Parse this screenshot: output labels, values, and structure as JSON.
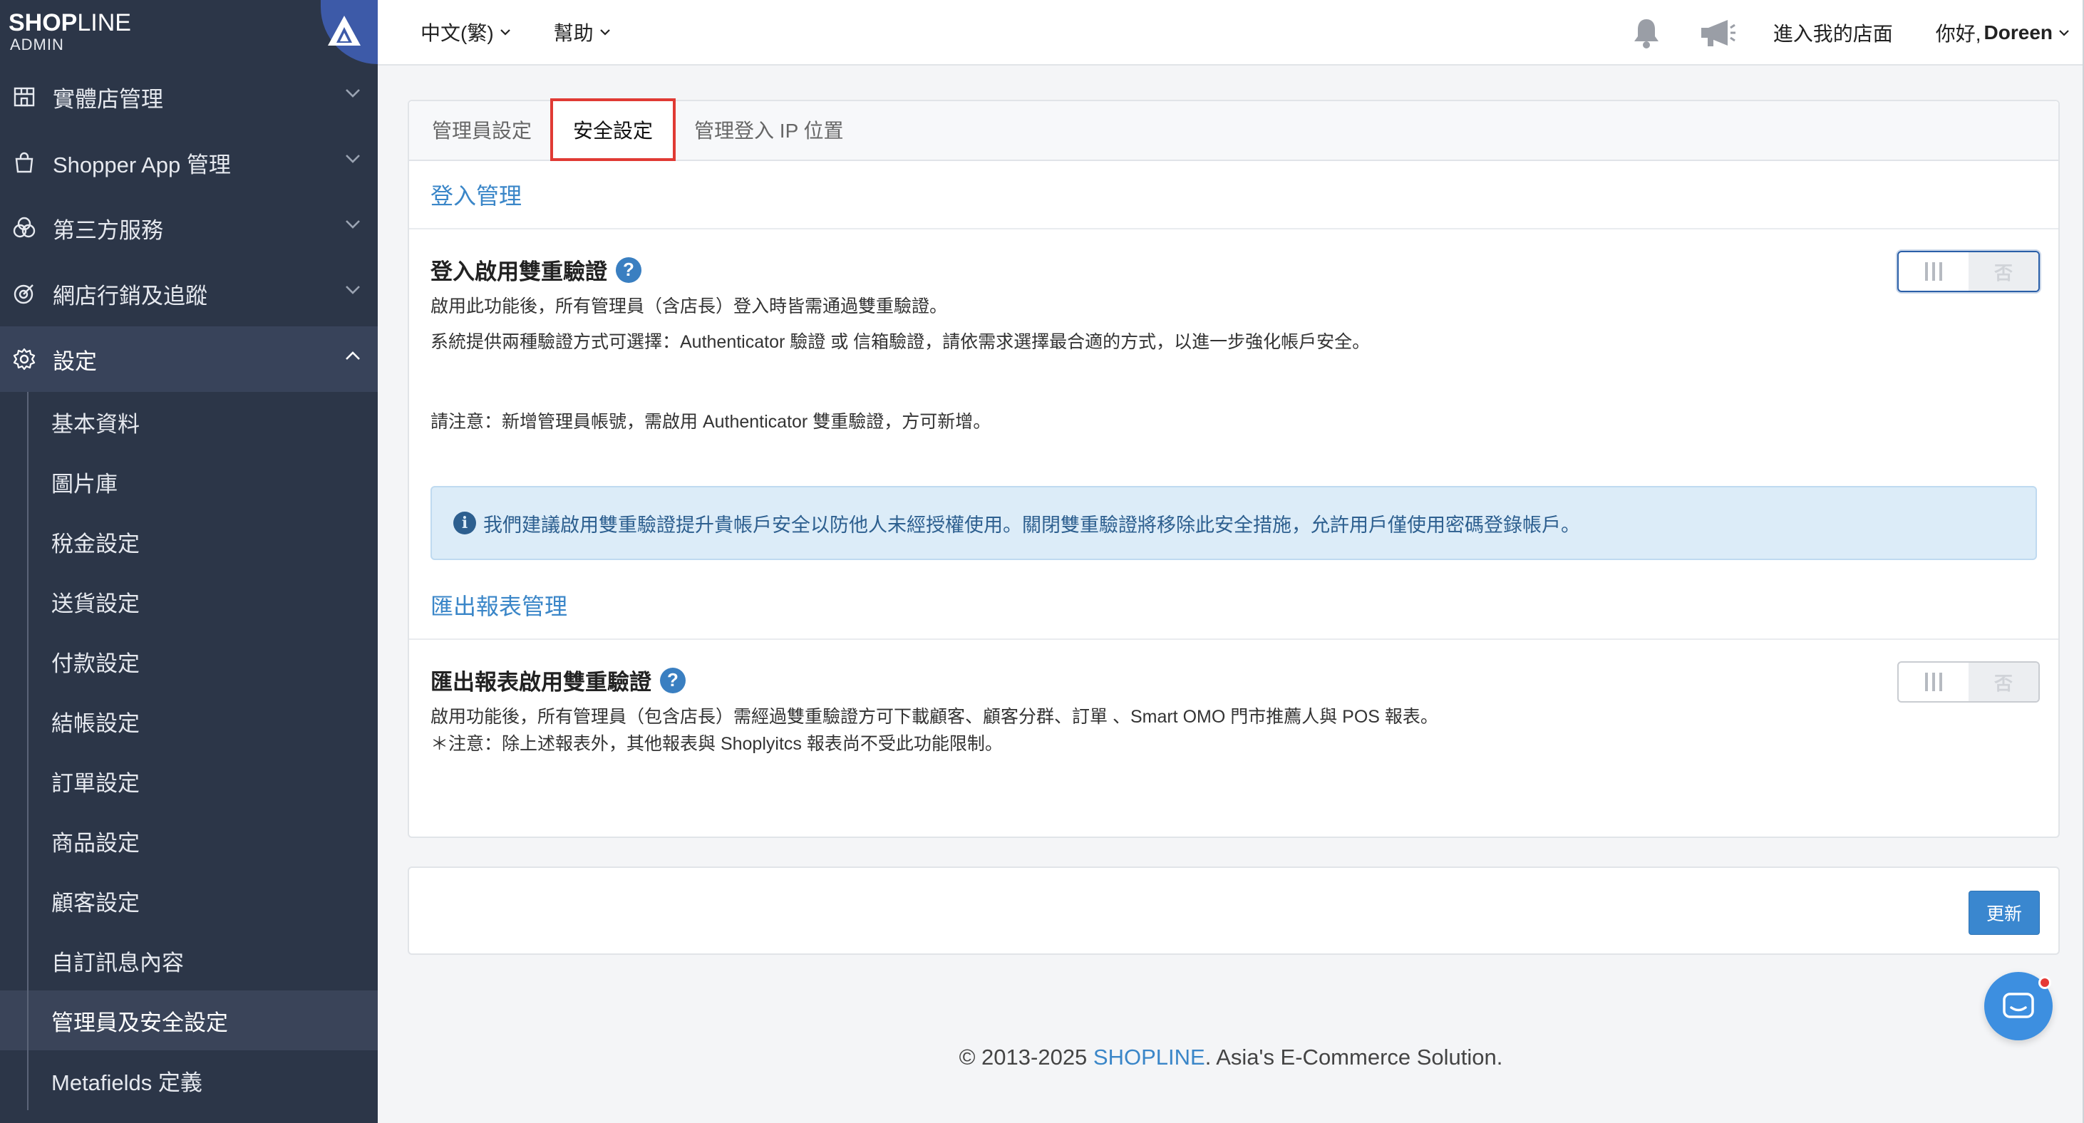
{
  "brand": {
    "name_bold": "SHOP",
    "name_thin": "LINE",
    "sub": "ADMIN"
  },
  "sidebar": {
    "items": [
      {
        "label": "實體店管理",
        "icon": "store-icon"
      },
      {
        "label": "Shopper App 管理",
        "icon": "shopping-bag-icon"
      },
      {
        "label": "第三方服務",
        "icon": "integrations-icon"
      },
      {
        "label": "網店行銷及追蹤",
        "icon": "target-icon"
      },
      {
        "label": "設定",
        "icon": "gear-icon"
      }
    ],
    "submenu": [
      "基本資料",
      "圖片庫",
      "稅金設定",
      "送貨設定",
      "付款設定",
      "結帳設定",
      "訂單設定",
      "商品設定",
      "顧客設定",
      "自訂訊息內容",
      "管理員及安全設定",
      "Metafields 定義"
    ]
  },
  "topbar": {
    "language": "中文(繁)",
    "help": "幫助",
    "storefront": "進入我的店面",
    "greeting": "你好,",
    "user": "Doreen"
  },
  "tabs": [
    "管理員設定",
    "安全設定",
    "管理登入 IP 位置"
  ],
  "login_section": {
    "title": "登入管理",
    "setting_title": "登入啟用雙重驗證",
    "desc1": "啟用此功能後，所有管理員（含店長）登入時皆需通過雙重驗證。",
    "desc2": "系統提供兩種驗證方式可選擇：Authenticator 驗證 或 信箱驗證，請依需求選擇最合適的方式，以進一步強化帳戶安全。",
    "note": "請注意：新增管理員帳號，需啟用 Authenticator 雙重驗證，方可新增。",
    "toggle_off": "否",
    "alert": "我們建議啟用雙重驗證提升貴帳戶安全以防他人未經授權使用。關閉雙重驗證將移除此安全措施，允許用戶僅使用密碼登錄帳戶。"
  },
  "export_section": {
    "title": "匯出報表管理",
    "setting_title": "匯出報表啟用雙重驗證",
    "desc1": "啟用功能後，所有管理員（包含店長）需經過雙重驗證方可下載顧客、顧客分群、訂單 、Smart OMO 門市推薦人與 POS 報表。",
    "desc2": "＊注意：除上述報表外，其他報表與 Shoplyitcs 報表尚不受此功能限制。",
    "toggle_off": "否"
  },
  "footer": {
    "update_button": "更新",
    "copyright_prefix": "© 2013-2025 ",
    "copyright_brand": "SHOPLINE",
    "copyright_suffix": ". Asia's E-Commerce Solution."
  },
  "colors": {
    "sidebar_bg": "#2c3648",
    "accent": "#3a86c8",
    "tab_highlight": "#e03a34",
    "chat_fab": "#3d8fe0"
  }
}
